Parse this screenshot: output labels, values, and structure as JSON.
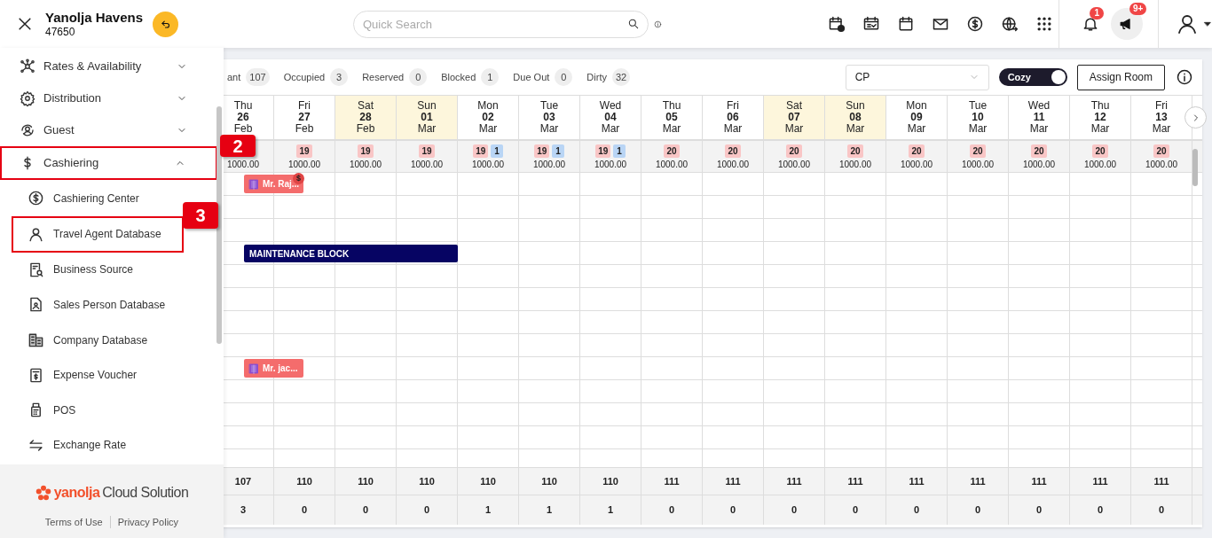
{
  "header": {
    "property_name": "Yanolja Havens",
    "property_id": "47650",
    "search": {
      "placeholder": "Quick Search"
    },
    "notifications_badge": "1",
    "announcements_badge": "9+"
  },
  "sidebar": {
    "items": [
      {
        "label": "Rates & Availability",
        "expanded": false
      },
      {
        "label": "Distribution",
        "expanded": false
      },
      {
        "label": "Guest",
        "expanded": false
      },
      {
        "label": "Cashiering",
        "expanded": true,
        "callout": "2",
        "children": [
          {
            "label": "Cashiering Center"
          },
          {
            "label": "Travel Agent Database",
            "callout": "3"
          },
          {
            "label": "Business Source"
          },
          {
            "label": "Sales Person Database"
          },
          {
            "label": "Company Database"
          },
          {
            "label": "Expense Voucher"
          },
          {
            "label": "POS"
          },
          {
            "label": "Exchange Rate"
          }
        ]
      }
    ],
    "footer": {
      "logo_word": "yanolja",
      "logo_tail": "Cloud Solution",
      "links": [
        "Terms of Use",
        "Privacy Policy"
      ]
    }
  },
  "stats": [
    {
      "label": "ant",
      "count": "107"
    },
    {
      "label": "Occupied",
      "count": "3"
    },
    {
      "label": "Reserved",
      "count": "0"
    },
    {
      "label": "Blocked",
      "count": "1"
    },
    {
      "label": "Due Out",
      "count": "0"
    },
    {
      "label": "Dirty",
      "count": "32"
    }
  ],
  "rate_select": {
    "value": "CP"
  },
  "view_toggle": {
    "label": "Cozy",
    "on": true
  },
  "assign_button": "Assign Room",
  "days": [
    {
      "dow": "Thu",
      "day": "26",
      "month": "Feb",
      "weekend": false,
      "rate": "1000.00",
      "summary": [
        "107",
        "3"
      ]
    },
    {
      "dow": "Fri",
      "day": "27",
      "month": "Feb",
      "weekend": false,
      "available": "19",
      "rate": "1000.00",
      "summary": [
        "110",
        "0"
      ]
    },
    {
      "dow": "Sat",
      "day": "28",
      "month": "Feb",
      "weekend": true,
      "available": "19",
      "rate": "1000.00",
      "summary": [
        "110",
        "0"
      ]
    },
    {
      "dow": "Sun",
      "day": "01",
      "month": "Mar",
      "weekend": true,
      "available": "19",
      "rate": "1000.00",
      "summary": [
        "110",
        "0"
      ]
    },
    {
      "dow": "Mon",
      "day": "02",
      "month": "Mar",
      "weekend": false,
      "available": "19",
      "blocked": "1",
      "rate": "1000.00",
      "summary": [
        "110",
        "1"
      ]
    },
    {
      "dow": "Tue",
      "day": "03",
      "month": "Mar",
      "weekend": false,
      "available": "19",
      "blocked": "1",
      "rate": "1000.00",
      "summary": [
        "110",
        "1"
      ]
    },
    {
      "dow": "Wed",
      "day": "04",
      "month": "Mar",
      "weekend": false,
      "available": "19",
      "blocked": "1",
      "rate": "1000.00",
      "summary": [
        "110",
        "1"
      ]
    },
    {
      "dow": "Thu",
      "day": "05",
      "month": "Mar",
      "weekend": false,
      "available": "20",
      "rate": "1000.00",
      "summary": [
        "111",
        "0"
      ]
    },
    {
      "dow": "Fri",
      "day": "06",
      "month": "Mar",
      "weekend": false,
      "available": "20",
      "rate": "1000.00",
      "summary": [
        "111",
        "0"
      ]
    },
    {
      "dow": "Sat",
      "day": "07",
      "month": "Mar",
      "weekend": true,
      "available": "20",
      "rate": "1000.00",
      "summary": [
        "111",
        "0"
      ]
    },
    {
      "dow": "Sun",
      "day": "08",
      "month": "Mar",
      "weekend": true,
      "available": "20",
      "rate": "1000.00",
      "summary": [
        "111",
        "0"
      ]
    },
    {
      "dow": "Mon",
      "day": "09",
      "month": "Mar",
      "weekend": false,
      "available": "20",
      "rate": "1000.00",
      "summary": [
        "111",
        "0"
      ]
    },
    {
      "dow": "Tue",
      "day": "10",
      "month": "Mar",
      "weekend": false,
      "available": "20",
      "rate": "1000.00",
      "summary": [
        "111",
        "0"
      ]
    },
    {
      "dow": "Wed",
      "day": "11",
      "month": "Mar",
      "weekend": false,
      "available": "20",
      "rate": "1000.00",
      "summary": [
        "111",
        "0"
      ]
    },
    {
      "dow": "Thu",
      "day": "12",
      "month": "Mar",
      "weekend": false,
      "available": "20",
      "rate": "1000.00",
      "summary": [
        "111",
        "0"
      ]
    },
    {
      "dow": "Fri",
      "day": "13",
      "month": "Mar",
      "weekend": false,
      "available": "20",
      "rate": "1000.00",
      "summary": [
        "111",
        "0"
      ]
    }
  ],
  "bookings": [
    {
      "kind": "reservation",
      "label": "Mr. Raj...",
      "payment_flag": "$"
    },
    {
      "kind": "block",
      "label": "MAINTENANCE BLOCK"
    },
    {
      "kind": "reservation",
      "label": "Mr. jac..."
    }
  ]
}
